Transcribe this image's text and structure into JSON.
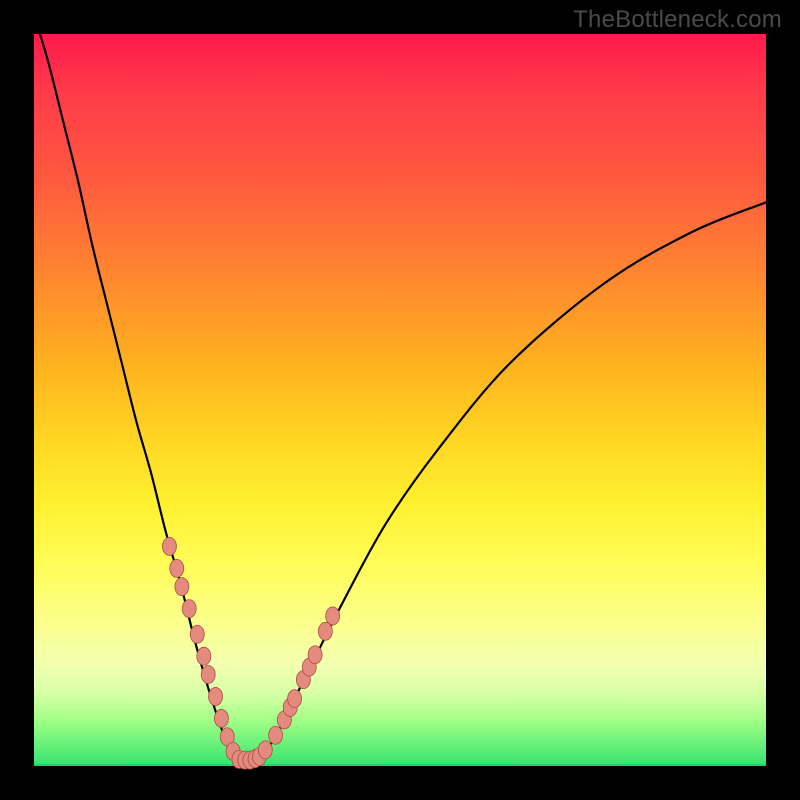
{
  "watermark": "TheBottleneck.com",
  "colors": {
    "bead_fill": "#e58a7f",
    "bead_stroke": "#a84f43",
    "curve": "#000000"
  },
  "chart_data": {
    "type": "line",
    "title": "",
    "xlabel": "",
    "ylabel": "",
    "xlim": [
      0,
      100
    ],
    "ylim": [
      0,
      100
    ],
    "grid": false,
    "legend": false,
    "note": "Minimum of the curve ≈ 0 at x ≈ 28; rises steeply left toward 100 and gently right toward ~77.",
    "series": [
      {
        "name": "curve",
        "x": [
          0.5,
          2,
          4,
          6,
          8,
          10,
          12,
          14,
          16,
          18,
          20,
          22,
          24,
          26,
          27,
          28,
          29,
          31,
          33,
          35,
          38,
          42,
          48,
          55,
          65,
          78,
          90,
          100
        ],
        "y": [
          101,
          96,
          88,
          80,
          71,
          63,
          55,
          47,
          40,
          32,
          25,
          17,
          10,
          4,
          1.5,
          0.7,
          0.7,
          1.5,
          4,
          8,
          14,
          22,
          33,
          43,
          55,
          66,
          73,
          77
        ]
      }
    ],
    "markers": {
      "name": "beads",
      "x": [
        18.5,
        19.5,
        20.2,
        21.2,
        22.3,
        23.2,
        23.8,
        24.8,
        25.6,
        26.4,
        27.2,
        28.0,
        28.8,
        29.5,
        30.2,
        30.8,
        31.6,
        33.0,
        34.2,
        35.0,
        35.6,
        36.8,
        37.6,
        38.4,
        39.8,
        40.8
      ],
      "y": [
        30.0,
        27.0,
        24.5,
        21.5,
        18.0,
        15.0,
        12.5,
        9.5,
        6.5,
        4.0,
        2.0,
        0.9,
        0.8,
        0.8,
        1.0,
        1.3,
        2.2,
        4.2,
        6.3,
        8.0,
        9.2,
        11.8,
        13.5,
        15.2,
        18.4,
        20.5
      ]
    }
  }
}
